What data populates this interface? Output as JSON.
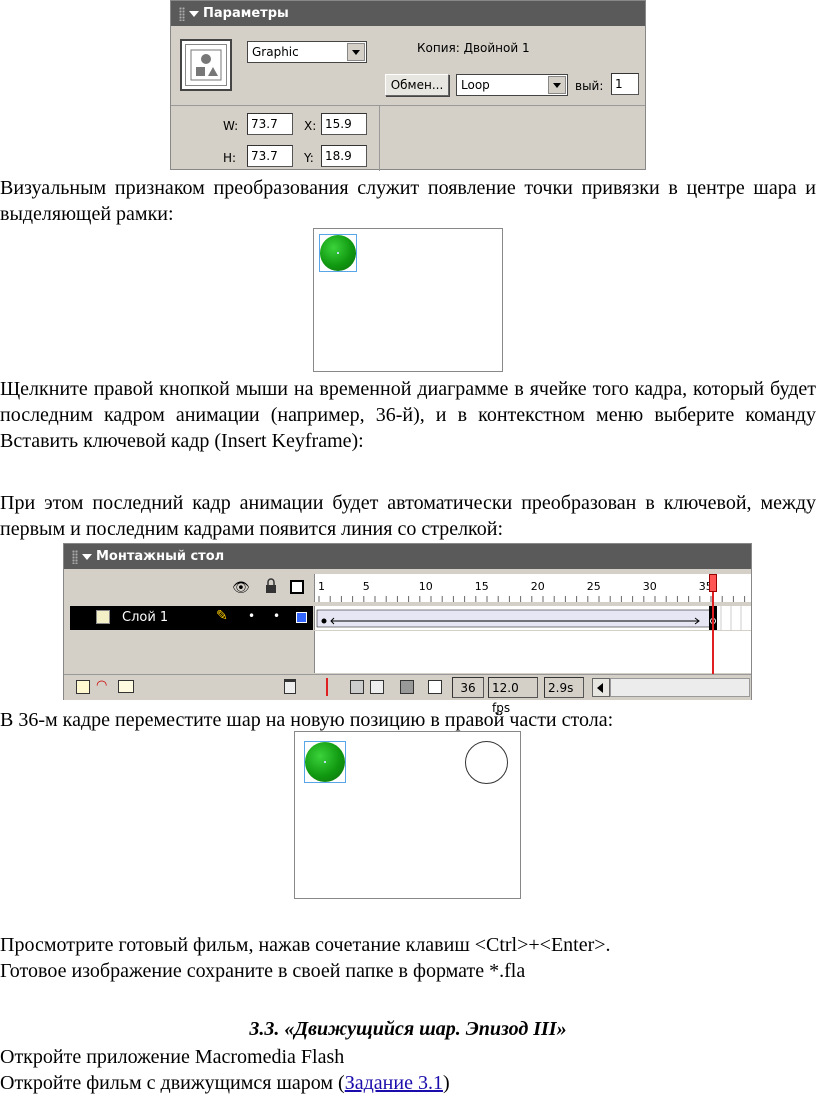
{
  "properties_panel": {
    "title": "Параметры",
    "symbol_type": "Graphic",
    "instance_label": "Копия: Двойной 1",
    "swap_button": "Обмен...",
    "loop_option": "Loop",
    "first_label": "вый:",
    "first_value": "1",
    "w_label": "W:",
    "w_value": "73.7",
    "h_label": "H:",
    "h_value": "73.7",
    "x_label": "X:",
    "x_value": "15.9",
    "y_label": "Y:",
    "y_value": "18.9"
  },
  "text": {
    "p1": "Визуальным признаком преобразования служит появление точки привязки в центре шара и выделяющей рамки:",
    "p2": "Щелкните правой кнопкой мыши на временной диаграмме в ячейке того кадра, который будет последним кадром анимации (например, 36-й), и в контекстном меню выберите команду Вставить ключевой кадр (Insert Keyframe):",
    "p3": "При этом последний кадр анимации будет автоматически преобразован в ключевой, между первым и последним кадрами появится линия со стрелкой:",
    "p4": "В 36-м кадре переместите шар на новую позицию в правой части стола:",
    "p5": "Просмотрите готовый фильм, нажав сочетание клавиш <Ctrl>+<Enter>.",
    "p6": "Готовое изображение сохраните в своей папке в формате *.fla",
    "heading": "3.3. «Движущийся шар. Эпизод III»",
    "p7": "Откройте приложение Macromedia Flash",
    "p8_before": "Откройте фильм с движущимся шаром (",
    "p8_link": "Задание 3.1",
    "p8_after": ")"
  },
  "timeline_panel": {
    "title": "Монтажный стол",
    "layer_name": "Слой 1",
    "frame_ticks": [
      "1",
      "5",
      "10",
      "15",
      "20",
      "25",
      "30",
      "35"
    ],
    "current_frame": "36",
    "fps": "12.0 fps",
    "time": "2.9s"
  },
  "colors": {
    "panel_header": "#5a5a5a",
    "panel_body": "#d4d0c8",
    "ball": "#119911",
    "playhead": "#e02020",
    "selection": "#58a6e8"
  }
}
